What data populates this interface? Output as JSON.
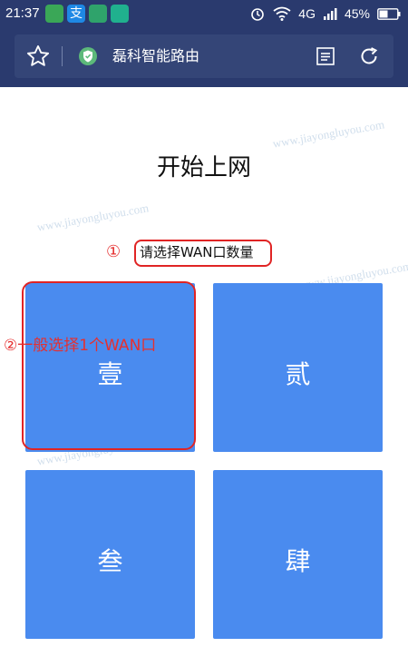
{
  "status_bar": {
    "time": "21:37",
    "network": "4G",
    "battery": "45%"
  },
  "url_bar": {
    "title": "磊科智能路由"
  },
  "page": {
    "title": "开始上网",
    "subtitle": "请选择WAN口数量",
    "step1_marker": "①",
    "annotation": "②一般选择1个WAN口"
  },
  "options": [
    {
      "label": "壹"
    },
    {
      "label": "贰"
    },
    {
      "label": "叁"
    },
    {
      "label": "肆"
    }
  ],
  "colors": {
    "header_bg": "#2a3a6e",
    "tile_bg": "#4a8bef",
    "annotation_red": "#e02424"
  }
}
